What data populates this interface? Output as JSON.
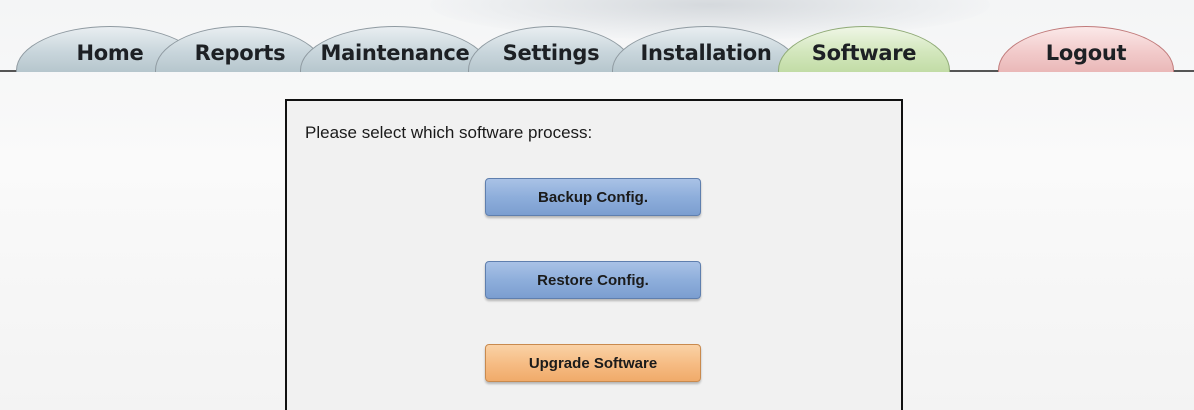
{
  "nav": {
    "tabs": [
      {
        "label": "Home"
      },
      {
        "label": "Reports"
      },
      {
        "label": "Maintenance"
      },
      {
        "label": "Settings"
      },
      {
        "label": "Installation"
      },
      {
        "label": "Software",
        "active": true
      },
      {
        "label": "Logout"
      }
    ]
  },
  "panel": {
    "prompt": "Please select which software process:",
    "buttons": {
      "backup": "Backup Config.",
      "restore": "Restore Config.",
      "upgrade": "Upgrade Software"
    }
  },
  "colors": {
    "active_tab": "#d3e7bd",
    "inactive_tab": "#c9d6dc",
    "logout_tab": "#f2cbcb",
    "blue_button": "#8eaedb",
    "orange_button": "#f6bd85"
  }
}
